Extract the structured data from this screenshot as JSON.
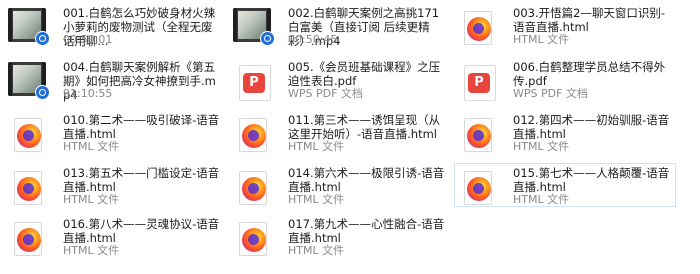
{
  "files": [
    {
      "name": "001.白鹤怎么巧妙破身材火辣小萝莉的废物测试（全程无废话用聊...",
      "meta": "00:50:01",
      "icon": "video-icon"
    },
    {
      "name": "002.白鹤聊天案例之高挑171白富美（直接订阅 后续更精彩）.mp4",
      "meta": "00:50:45",
      "icon": "video-icon"
    },
    {
      "name": "003.开悟篇2—聊天窗口识别-语音直播.html",
      "meta": "HTML 文件",
      "icon": "html-icon"
    },
    {
      "name": "004.白鹤聊天案例解析《第五期》如何把高冷女神撩到手.mp4",
      "meta": "01:10:55",
      "icon": "video-icon"
    },
    {
      "name": "005.《会员班基础课程》之压迫性表白.pdf",
      "meta": "WPS PDF 文档",
      "icon": "pdf-icon"
    },
    {
      "name": "006.白鹤整理学员总结不得外传.pdf",
      "meta": "WPS PDF 文档",
      "icon": "pdf-icon"
    },
    {
      "name": "010.第二术——吸引破译-语音直播.html",
      "meta": "HTML 文件",
      "icon": "html-icon"
    },
    {
      "name": "011.第三术——诱饵呈现（从这里开始听）-语音直播.html",
      "meta": "HTML 文件",
      "icon": "html-icon"
    },
    {
      "name": "012.第四术——初始驯服-语音直播.html",
      "meta": "HTML 文件",
      "icon": "html-icon"
    },
    {
      "name": "013.第五术——门槛设定-语音直播.html",
      "meta": "HTML 文件",
      "icon": "html-icon"
    },
    {
      "name": "014.第六术——极限引诱-语音直播.html",
      "meta": "HTML 文件",
      "icon": "html-icon"
    },
    {
      "name": "015.第七术——人格颠覆-语音直播.html",
      "meta": "HTML 文件",
      "icon": "html-icon",
      "selected": true
    },
    {
      "name": "016.第八术——灵魂协议-语音直播.html",
      "meta": "HTML 文件",
      "icon": "html-icon"
    },
    {
      "name": "017.第九术——心性融合-语音直播.html",
      "meta": "HTML 文件",
      "icon": "html-icon"
    }
  ]
}
